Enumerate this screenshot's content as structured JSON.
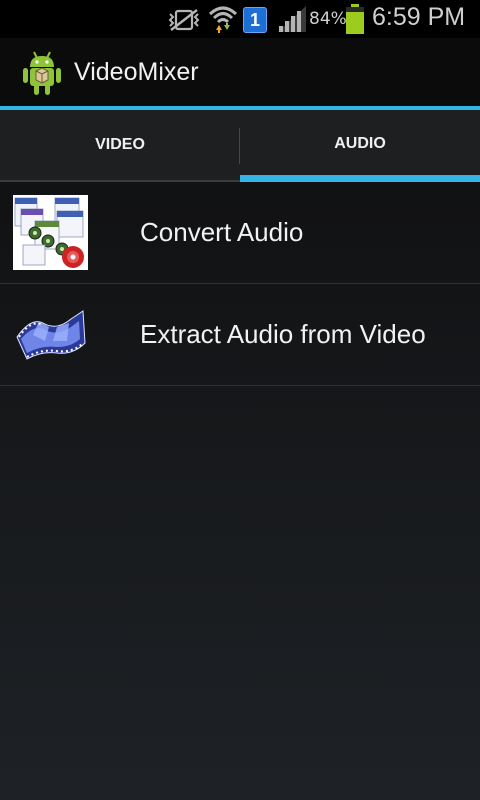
{
  "status_bar": {
    "icons": [
      "muted-vibrate-icon",
      "wifi-icon",
      "notification-1-icon",
      "signal-icon",
      "battery-icon"
    ],
    "notification_count": "1",
    "battery_percent": "84%",
    "time": "6:59 PM",
    "accent_color": "#33b5e5"
  },
  "action_bar": {
    "app_icon": "android-app-icon",
    "title": "VideoMixer"
  },
  "tabs": [
    {
      "label": "VIDEO",
      "selected": false
    },
    {
      "label": "AUDIO",
      "selected": true
    }
  ],
  "list": {
    "items": [
      {
        "icon": "audio-formats-icon",
        "label": "Convert Audio"
      },
      {
        "icon": "film-strip-icon",
        "label": "Extract Audio from Video"
      }
    ]
  }
}
